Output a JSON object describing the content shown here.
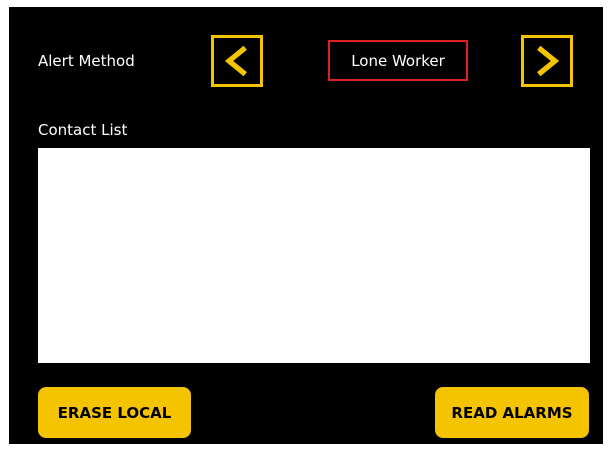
{
  "header": {
    "alert_method_label": "Alert Method",
    "selected_mode": "Lone Worker",
    "prev_icon": "chevron-left-icon",
    "next_icon": "chevron-right-icon"
  },
  "contacts": {
    "label": "Contact List",
    "items": []
  },
  "actions": {
    "erase_label": "ERASE LOCAL",
    "read_label": "READ ALARMS"
  },
  "colors": {
    "accent": "#f5c400",
    "selection_border": "#e02020",
    "background": "#000000"
  }
}
